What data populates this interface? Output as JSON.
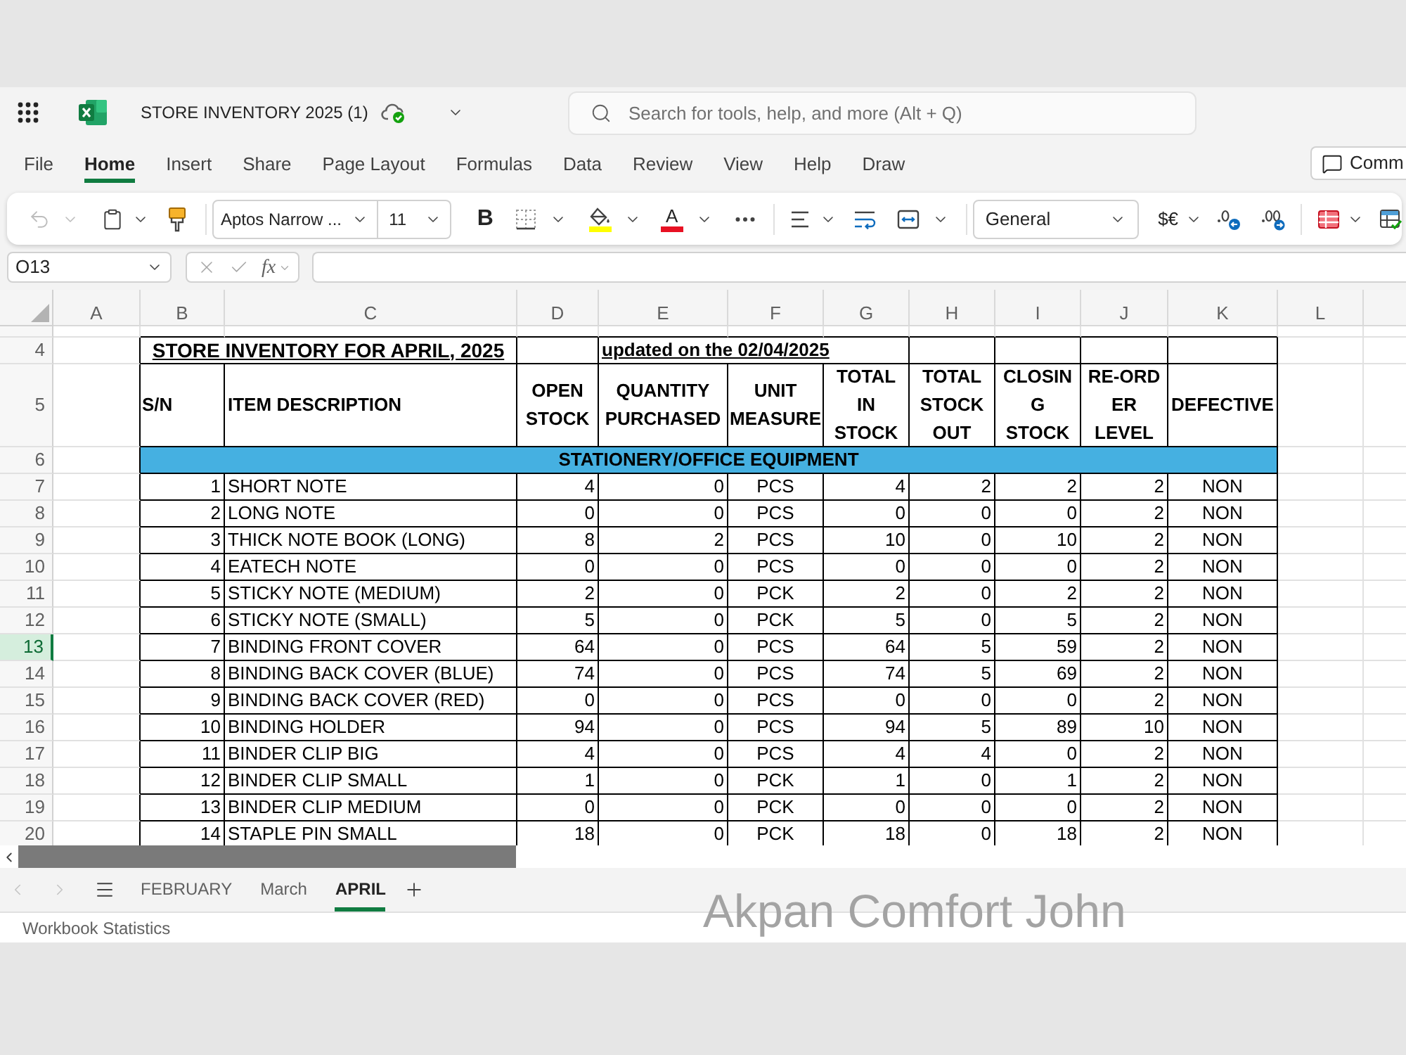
{
  "app": {
    "title": "STORE INVENTORY 2025 (1)",
    "search": {
      "placeholder": "Search for tools, help, and more (Alt + Q)"
    }
  },
  "menu_tabs": [
    {
      "label": "File",
      "selected": false
    },
    {
      "label": "Home",
      "selected": true
    },
    {
      "label": "Insert",
      "selected": false
    },
    {
      "label": "Share",
      "selected": false
    },
    {
      "label": "Page Layout",
      "selected": false
    },
    {
      "label": "Formulas",
      "selected": false
    },
    {
      "label": "Data",
      "selected": false
    },
    {
      "label": "Review",
      "selected": false
    },
    {
      "label": "View",
      "selected": false
    },
    {
      "label": "Help",
      "selected": false
    },
    {
      "label": "Draw",
      "selected": false
    }
  ],
  "comments_button": {
    "label": "Comm"
  },
  "ribbon": {
    "undo": {
      "disabled": true
    },
    "font_name": "Aptos Narrow ...",
    "font_size": "11",
    "bold": "B",
    "font_color": "A",
    "number_format": "General",
    "currency": "$€"
  },
  "formula_bar": {
    "name_box": "O13",
    "function_label": "fx"
  },
  "sheet": {
    "columns": [
      "A",
      "B",
      "C",
      "D",
      "E",
      "F",
      "G",
      "H",
      "I",
      "J",
      "K",
      "L"
    ],
    "row_numbers": [
      {
        "label": "4",
        "selected": false
      },
      {
        "label": "5",
        "selected": false
      },
      {
        "label": "6",
        "selected": false
      },
      {
        "label": "7",
        "selected": false
      },
      {
        "label": "8",
        "selected": false
      },
      {
        "label": "9",
        "selected": false
      },
      {
        "label": "10",
        "selected": false
      },
      {
        "label": "11",
        "selected": false
      },
      {
        "label": "12",
        "selected": false
      },
      {
        "label": "13",
        "selected": true
      },
      {
        "label": "14",
        "selected": false
      },
      {
        "label": "15",
        "selected": false
      },
      {
        "label": "16",
        "selected": false
      },
      {
        "label": "17",
        "selected": false
      },
      {
        "label": "18",
        "selected": false
      },
      {
        "label": "19",
        "selected": false
      },
      {
        "label": "20",
        "selected": false
      }
    ],
    "title_row": {
      "title": "STORE INVENTORY FOR APRIL, 2025",
      "updated": "updated on the 02/04/2025"
    },
    "header_row": [
      "S/N",
      "ITEM DESCRIPTION",
      "OPEN STOCK",
      "QUANTITY PURCHASED",
      "UNIT MEASURE",
      "TOTAL IN STOCK",
      "TOTAL STOCK OUT",
      "CLOSING STOCK",
      "RE-ORDER LEVEL",
      "DEFECTIVE"
    ],
    "section_row": {
      "label": "STATIONERY/OFFICE EQUIPMENT"
    },
    "rows": [
      {
        "cells": [
          "",
          "1",
          "SHORT NOTE",
          "4",
          "0",
          "PCS",
          "4",
          "2",
          "2",
          "2",
          "NON"
        ]
      },
      {
        "cells": [
          "",
          "2",
          "LONG NOTE",
          "0",
          "0",
          "PCS",
          "0",
          "0",
          "0",
          "2",
          "NON"
        ]
      },
      {
        "cells": [
          "",
          "3",
          "THICK NOTE BOOK (LONG)",
          "8",
          "2",
          "PCS",
          "10",
          "0",
          "10",
          "2",
          "NON"
        ]
      },
      {
        "cells": [
          "",
          "4",
          "EATECH NOTE",
          "0",
          "0",
          "PCS",
          "0",
          "0",
          "0",
          "2",
          "NON"
        ]
      },
      {
        "cells": [
          "",
          "5",
          "STICKY NOTE (MEDIUM)",
          "2",
          "0",
          "PCK",
          "2",
          "0",
          "2",
          "2",
          "NON"
        ]
      },
      {
        "cells": [
          "",
          "6",
          "STICKY NOTE (SMALL)",
          "5",
          "0",
          "PCK",
          "5",
          "0",
          "5",
          "2",
          "NON"
        ]
      },
      {
        "cells": [
          "",
          "7",
          "BINDING FRONT COVER",
          "64",
          "0",
          "PCS",
          "64",
          "5",
          "59",
          "2",
          "NON"
        ]
      },
      {
        "cells": [
          "",
          "8",
          "BINDING BACK COVER (BLUE)",
          "74",
          "0",
          "PCS",
          "74",
          "5",
          "69",
          "2",
          "NON"
        ]
      },
      {
        "cells": [
          "",
          "9",
          "BINDING BACK COVER (RED)",
          "0",
          "0",
          "PCS",
          "0",
          "0",
          "0",
          "2",
          "NON"
        ]
      },
      {
        "cells": [
          "",
          "10",
          "BINDING HOLDER",
          "94",
          "0",
          "PCS",
          "94",
          "5",
          "89",
          "10",
          "NON"
        ]
      },
      {
        "cells": [
          "",
          "11",
          "BINDER CLIP BIG",
          "4",
          "0",
          "PCS",
          "4",
          "4",
          "0",
          "2",
          "NON"
        ]
      },
      {
        "cells": [
          "",
          "12",
          "BINDER CLIP SMALL",
          "1",
          "0",
          "PCK",
          "1",
          "0",
          "1",
          "2",
          "NON"
        ]
      },
      {
        "cells": [
          "",
          "13",
          "BINDER CLIP MEDIUM",
          "0",
          "0",
          "PCK",
          "0",
          "0",
          "0",
          "2",
          "NON"
        ]
      },
      {
        "cells": [
          "",
          "14",
          "STAPLE PIN SMALL",
          "18",
          "0",
          "PCK",
          "18",
          "0",
          "18",
          "2",
          "NON"
        ]
      }
    ]
  },
  "sheet_nav": {
    "prev_disabled": true,
    "next_disabled": true
  },
  "sheet_tabs": [
    {
      "label": "FEBRUARY",
      "selected": false
    },
    {
      "label": "March",
      "selected": false
    },
    {
      "label": "APRIL",
      "selected": true
    }
  ],
  "status_bar": {
    "text": "Workbook Statistics"
  },
  "overlay_text": "Akpan Comfort John"
}
